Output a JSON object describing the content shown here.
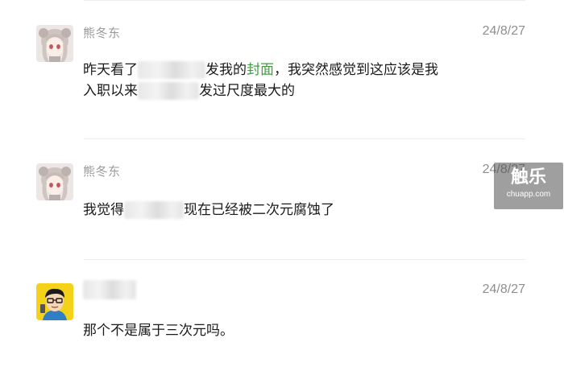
{
  "messages": [
    {
      "name": "熊冬东",
      "date": "24/8/27",
      "line1_a": "昨天看了",
      "line1_b": "发我的",
      "line1_c": "封面",
      "line1_d": "，我突然感觉到这应该是我",
      "line2_a": "入职以来",
      "line2_b": "发过尺度最大的"
    },
    {
      "name": "熊冬东",
      "date": "24/8/27",
      "text_a": "我觉得",
      "text_b": "现在已经被二次元腐蚀了"
    },
    {
      "name": "",
      "date": "24/8/27",
      "text": "那个不是属于三次元吗。"
    }
  ],
  "watermark": {
    "main": "触乐",
    "sub": "chuapp.com"
  },
  "colors": {
    "highlight": "#3f9e3f",
    "meta": "#9a9a9a"
  }
}
